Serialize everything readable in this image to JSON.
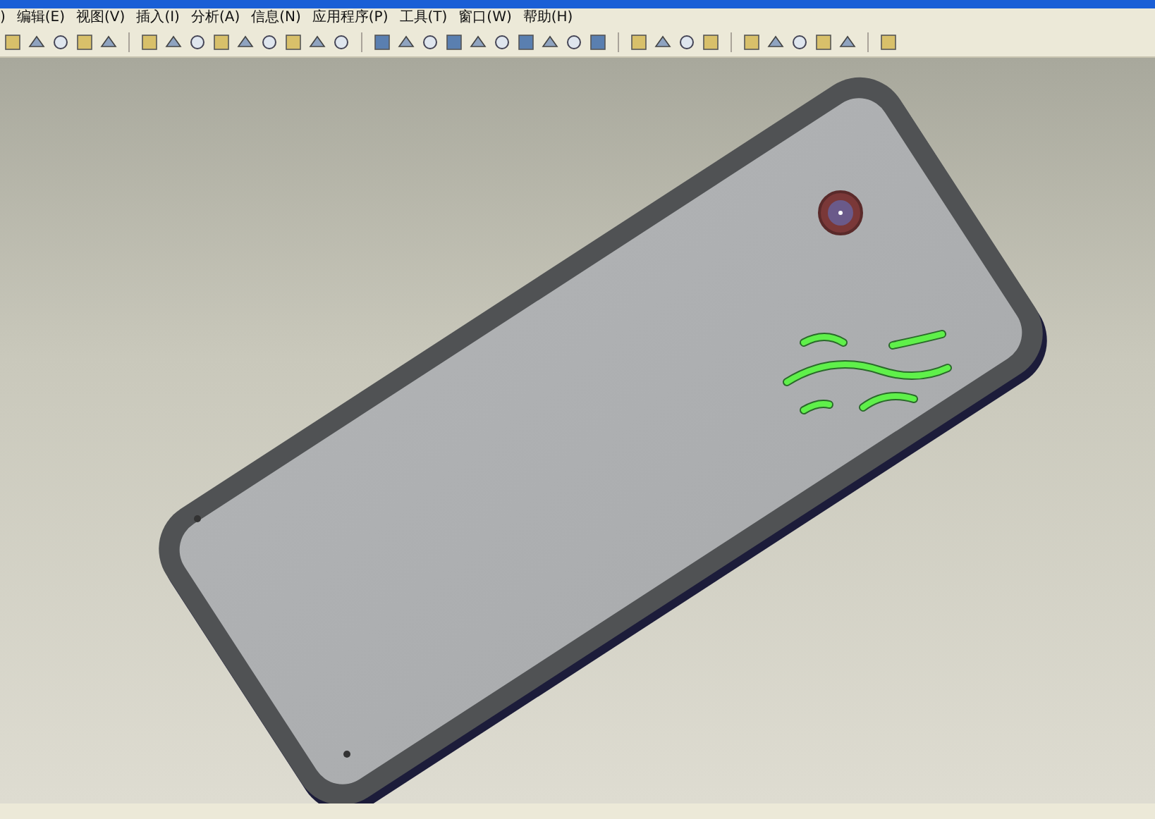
{
  "menu_bar": {
    "items": [
      {
        "label": ")"
      },
      {
        "label": "编辑(E)"
      },
      {
        "label": "视图(V)"
      },
      {
        "label": "插入(I)"
      },
      {
        "label": "分析(A)"
      },
      {
        "label": "信息(N)"
      },
      {
        "label": "应用程序(P)"
      },
      {
        "label": "工具(T)"
      },
      {
        "label": "窗口(W)"
      },
      {
        "label": "帮助(H)"
      }
    ]
  }
}
